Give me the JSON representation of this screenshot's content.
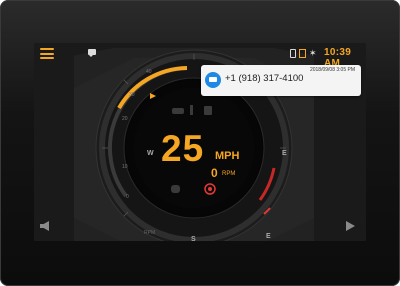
{
  "status_bar": {
    "time": "10:39 AM",
    "icons": [
      "menu-icon",
      "message-icon",
      "wifi-icon",
      "bluetooth-icon",
      "battery-icon"
    ]
  },
  "notification": {
    "phone": "+1 (918) 317-4100",
    "timestamp": "2018/09/08 3:05 PM",
    "icon": "message-icon",
    "accent_color": "#1e88e5"
  },
  "gauge": {
    "speed": "25",
    "speed_unit": "MPH",
    "rpm": "0",
    "rpm_unit": "RPM",
    "scale_labels": [
      "40",
      "30",
      "20",
      "10",
      "0"
    ],
    "compass": {
      "west": "W",
      "east": "E",
      "south": "S",
      "south_east": "E"
    },
    "rpm_scale_label": "RPM",
    "indicators": [
      "oil-icon",
      "temperature-icon",
      "fuel-icon",
      "headlight-icon",
      "brake-warning-icon"
    ]
  },
  "colors": {
    "accent": "#f5a623",
    "warning": "#e53935",
    "background": "#1a1a1a"
  }
}
